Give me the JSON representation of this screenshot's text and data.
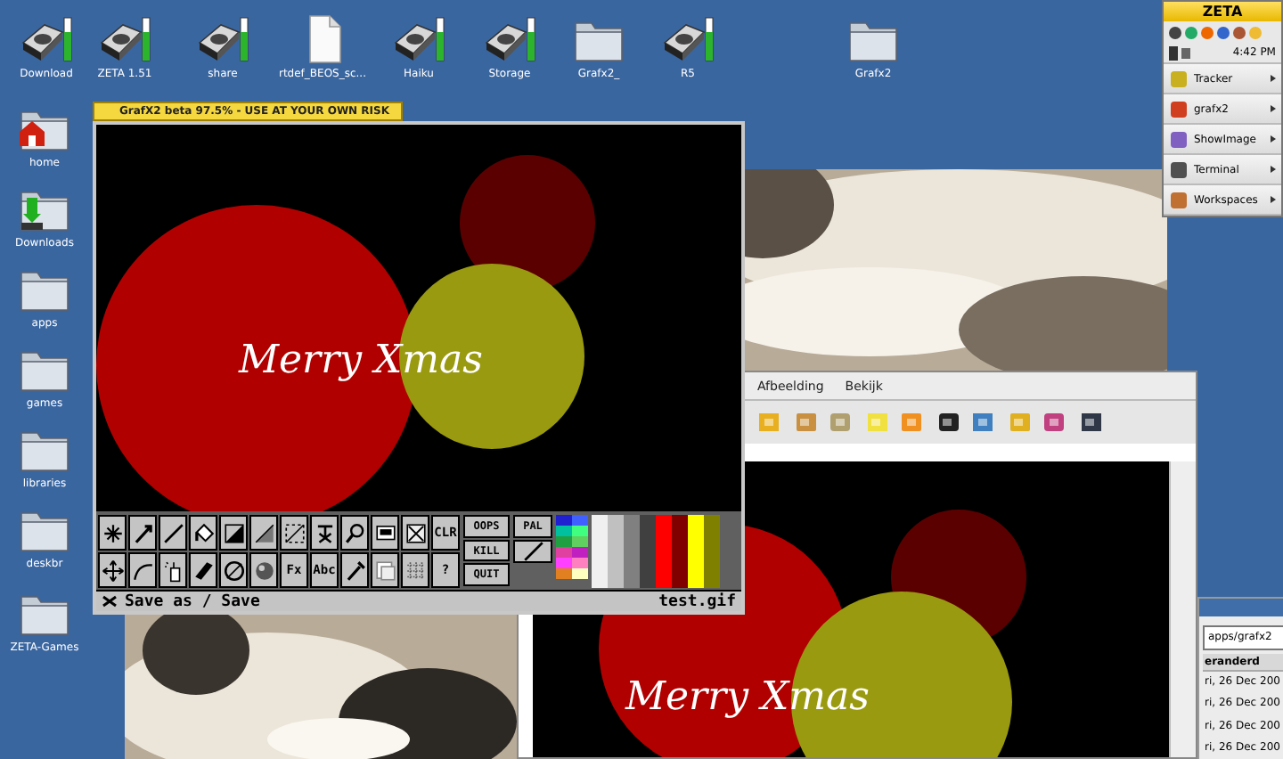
{
  "desktop_icons": [
    {
      "label": "Download",
      "kind": "drive"
    },
    {
      "label": "ZETA 1.51",
      "kind": "drive"
    },
    {
      "label": "share",
      "kind": "drive"
    },
    {
      "label": "rtdef_BEOS_sc...",
      "kind": "document"
    },
    {
      "label": "Haiku",
      "kind": "drive"
    },
    {
      "label": "Storage",
      "kind": "drive"
    },
    {
      "label": "Grafx2_",
      "kind": "folder"
    },
    {
      "label": "R5",
      "kind": "drive"
    },
    {
      "label": "Grafx2",
      "kind": "folder"
    },
    {
      "label": "home",
      "kind": "home"
    },
    {
      "label": "Downloads",
      "kind": "download"
    },
    {
      "label": "apps",
      "kind": "folder"
    },
    {
      "label": "games",
      "kind": "folder"
    },
    {
      "label": "libraries",
      "kind": "folder"
    },
    {
      "label": "deskbr",
      "kind": "folder"
    },
    {
      "label": "ZETA-Games",
      "kind": "folder"
    }
  ],
  "deskbar": {
    "title": "ZETA",
    "clock": "4:42 PM",
    "items": [
      {
        "label": "Tracker"
      },
      {
        "label": "grafx2"
      },
      {
        "label": "ShowImage"
      },
      {
        "label": "Terminal"
      },
      {
        "label": "Workspaces"
      }
    ]
  },
  "viewer": {
    "menu": [
      "Afbeelding",
      "Bekijk"
    ],
    "canvas_text": "Merry Xmas"
  },
  "file_panel": {
    "path": "apps/grafx2",
    "column_header": "eranderd",
    "rows": [
      "ri, 26 Dec 200",
      "ri, 26 Dec 200",
      "ri, 26 Dec 200",
      "ri, 26 Dec 200"
    ]
  },
  "grafx": {
    "title": "GrafX2 beta 97.5% - USE AT YOUR OWN RISK",
    "canvas_text": "Merry Xmas",
    "tools": [
      {
        "kind": "icon"
      },
      {
        "kind": "icon"
      },
      {
        "kind": "icon"
      },
      {
        "kind": "icon"
      },
      {
        "kind": "icon"
      },
      {
        "kind": "icon"
      },
      {
        "kind": "icon"
      },
      {
        "kind": "icon"
      },
      {
        "kind": "icon"
      },
      {
        "kind": "icon"
      },
      {
        "kind": "icon"
      },
      {
        "kind": "icon"
      },
      {
        "kind": "icon"
      },
      {
        "kind": "text",
        "label": "Fx"
      },
      {
        "kind": "icon"
      },
      {
        "kind": "text",
        "label": "Abc"
      },
      {
        "kind": "icon"
      },
      {
        "kind": "icon"
      },
      {
        "kind": "icon"
      },
      {
        "kind": "icon"
      },
      {
        "kind": "icon"
      },
      {
        "kind": "icon"
      },
      {
        "kind": "text",
        "label": "CLR"
      },
      {
        "kind": "text",
        "label": "?"
      }
    ],
    "side_buttons": [
      "OOPS",
      "KILL",
      "QUIT"
    ],
    "palette_button": "PAL",
    "palette": [
      {
        "color": "#2020d0"
      },
      {
        "color": "#4060ff"
      },
      {
        "color": "#00c0a0"
      },
      {
        "color": "#40ff80"
      },
      {
        "color": "#20a040"
      },
      {
        "color": "#60d060"
      },
      {
        "color": "#e040a0"
      },
      {
        "color": "#c020c0"
      },
      {
        "color": "#ff40ff"
      },
      {
        "color": "#ff80c0"
      },
      {
        "color": "#e08020"
      },
      {
        "color": "#ffffc0"
      }
    ],
    "stripes": [
      {
        "color": "#f0f0f0"
      },
      {
        "color": "#c0c0c0"
      },
      {
        "color": "#808080"
      },
      {
        "color": "#404040"
      },
      {
        "color": "#ff0000"
      },
      {
        "color": "#800000"
      },
      {
        "color": "#ffff00"
      },
      {
        "color": "#808000"
      }
    ],
    "status": "Save as / Save",
    "filename": "test.gif"
  }
}
